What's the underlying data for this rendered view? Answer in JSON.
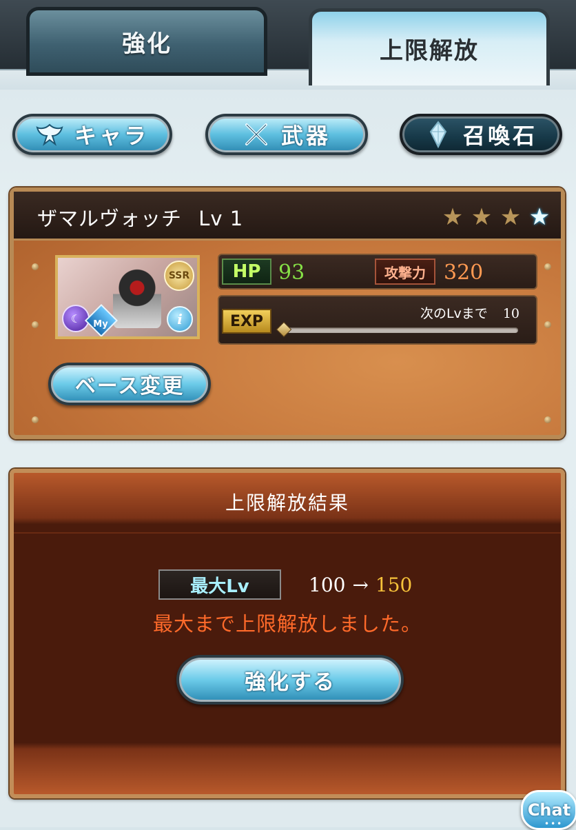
{
  "tabs": [
    {
      "label": "強化",
      "active": false
    },
    {
      "label": "上限解放",
      "active": true
    }
  ],
  "categories": [
    {
      "label": "キャラ",
      "icon": "character-crest-icon"
    },
    {
      "label": "武器",
      "icon": "crossed-swords-icon"
    },
    {
      "label": "召喚石",
      "icon": "crystal-icon"
    }
  ],
  "character": {
    "name": "ザマルヴォッチ",
    "level_label": "Lv 1",
    "rarity": "SSR",
    "my_badge": "My",
    "info_icon": "i",
    "uncaps_total": 4,
    "uncaps_gold": 3,
    "uncap_blue_mark": "4",
    "hp_label": "HP",
    "hp": "93",
    "atk_label": "攻撃力",
    "atk": "320",
    "exp_label": "EXP",
    "next_label": "次のLvまで",
    "next_value": "10",
    "exp_fill": 0.0,
    "base_change_label": "ベース変更"
  },
  "result": {
    "title": "上限解放結果",
    "max_lv_label": "最大Lv",
    "old_level": "100",
    "arrow": "→",
    "new_level": "150",
    "message": "最大まで上限解放しました。",
    "strengthen_label": "強化する"
  },
  "chat": {
    "label": "Chat",
    "dots": "•••"
  },
  "colors": {
    "accent_blue": "#5ebfe0",
    "panel_orange": "#c3743a",
    "result_dark": "#4a1b0c",
    "message_red": "#ff6a2a",
    "new_level_gold": "#f7c23a",
    "hp_green": "#86e046",
    "atk_orange": "#ff9a52"
  }
}
